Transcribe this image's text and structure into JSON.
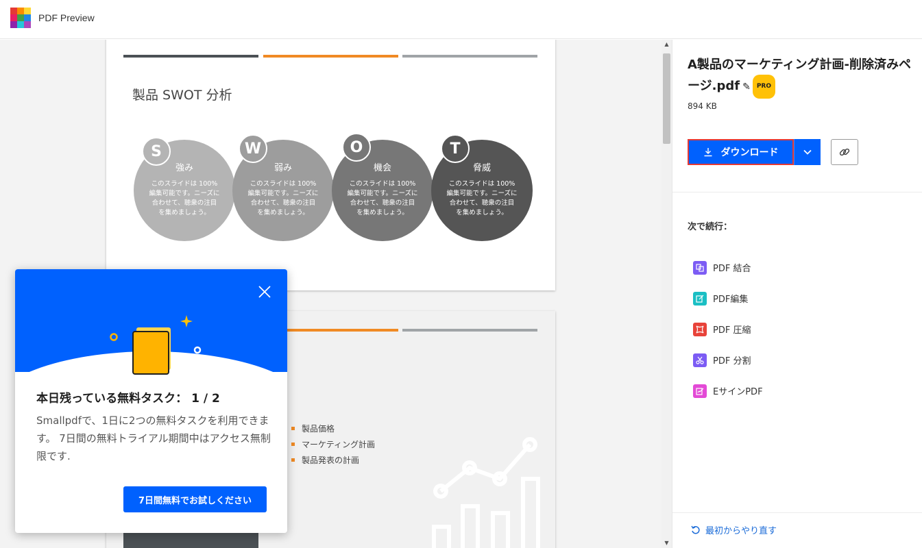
{
  "header": {
    "title": "PDF Preview"
  },
  "document": {
    "slide1": {
      "title": "製品 SWOT 分析",
      "circles": [
        {
          "letter": "S",
          "name": "強み",
          "desc": "このスライドは 100% 編集可能です。ニーズに合わせて、聴衆の注目を集めましょう。",
          "color": "#b4b4b4",
          "badge_color": "#b4b4b4"
        },
        {
          "letter": "W",
          "name": "弱み",
          "desc": "このスライドは 100% 編集可能です。ニーズに合わせて、聴衆の注目を集めましょう。",
          "color": "#9d9d9d",
          "badge_color": "#9d9d9d"
        },
        {
          "letter": "O",
          "name": "機会",
          "desc": "このスライドは 100% 編集可能です。ニーズに合わせて、聴衆の注目を集めましょう。",
          "color": "#777777",
          "badge_color": "#777777"
        },
        {
          "letter": "T",
          "name": "脅威",
          "desc": "このスライドは 100% 編集可能です。ニーズに合わせて、聴衆の注目を集めましょう。",
          "color": "#555555",
          "badge_color": "#555555"
        }
      ]
    },
    "slide2": {
      "bullets": [
        "製品価格",
        "マーケティング計画",
        "製品発表の計画"
      ]
    },
    "colors": {
      "bar_dark": "#4b5155",
      "bar_orange": "#f08a24",
      "bar_gray": "#a0a4a7"
    }
  },
  "sidebar": {
    "file_name": "A製品のマーケティング計画-削除済みページ.pdf",
    "pro_label": "PRO",
    "file_size": "894 KB",
    "download_label": "ダウンロード",
    "continue_heading": "次で続行：",
    "tools": [
      {
        "label": "PDF 結合",
        "icon": "merge-icon",
        "color": "#7c5cf4"
      },
      {
        "label": "PDF編集",
        "icon": "edit-icon",
        "color": "#1bbfc4"
      },
      {
        "label": "PDF 圧縮",
        "icon": "compress-icon",
        "color": "#e8433a"
      },
      {
        "label": "PDF 分割",
        "icon": "split-icon",
        "color": "#7c5cf4"
      },
      {
        "label": "EサインPDF",
        "icon": "esign-icon",
        "color": "#e34ad6"
      }
    ],
    "restart_label": "最初からやり直す"
  },
  "popup": {
    "title": "本日残っている無料タスク： 1 / 2",
    "body": "Smallpdfで、1日に2つの無料タスクを利用できます。 7日間の無料トライアル期間中はアクセス無制限です.",
    "cta_label": "7日間無料でお試しください"
  },
  "accent_color": "#0061fe"
}
